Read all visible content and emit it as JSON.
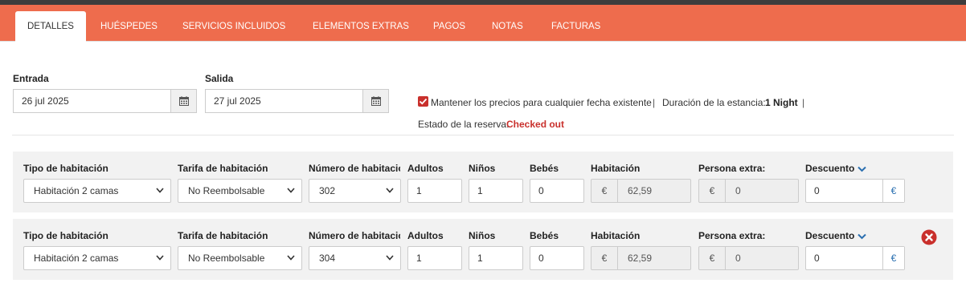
{
  "tabs": [
    {
      "label": "DETALLES"
    },
    {
      "label": "HUÉSPEDES"
    },
    {
      "label": "SERVICIOS INCLUIDOS"
    },
    {
      "label": "ELEMENTOS EXTRAS"
    },
    {
      "label": "PAGOS"
    },
    {
      "label": "NOTAS"
    },
    {
      "label": "FACTURAS"
    }
  ],
  "stay": {
    "checkin_label": "Entrada",
    "checkin_value": "26 jul 2025",
    "checkout_label": "Salida",
    "checkout_value": "27 jul 2025",
    "keep_prices_label": "Mantener los precios para cualquier fecha existente",
    "separator": "|",
    "duration_label": "Duración de la estancia:",
    "duration_value": "1 Night",
    "status_label": "Estado de la reserva:",
    "status_value": "Checked out"
  },
  "columns": {
    "room_type": "Tipo de habitación",
    "rate": "Tarifa de habitación",
    "room_number": "Número de habitación",
    "adults": "Adultos",
    "children": "Niños",
    "babies": "Bebés",
    "room_price": "Habitación",
    "extra_person": "Persona extra:",
    "discount": "Descuento"
  },
  "rooms": [
    {
      "room_type": "Habitación 2 camas",
      "rate": "No Reembolsable",
      "room_number": "302",
      "adults": "1",
      "children": "1",
      "babies": "0",
      "currency": "€",
      "room_price": "62,59",
      "extra_person": "0",
      "discount": "0",
      "discount_unit": "€"
    },
    {
      "room_type": "Habitación 2 camas",
      "rate": "No Reembolsable",
      "room_number": "304",
      "adults": "1",
      "children": "1",
      "babies": "0",
      "currency": "€",
      "room_price": "62,59",
      "extra_person": "0",
      "discount": "0",
      "discount_unit": "€"
    }
  ],
  "colors": {
    "tab_bar": "#ee6c4d",
    "top_strip": "#3d3d3d",
    "status_red": "#c9302c",
    "accent_blue": "#2a6fb0"
  }
}
